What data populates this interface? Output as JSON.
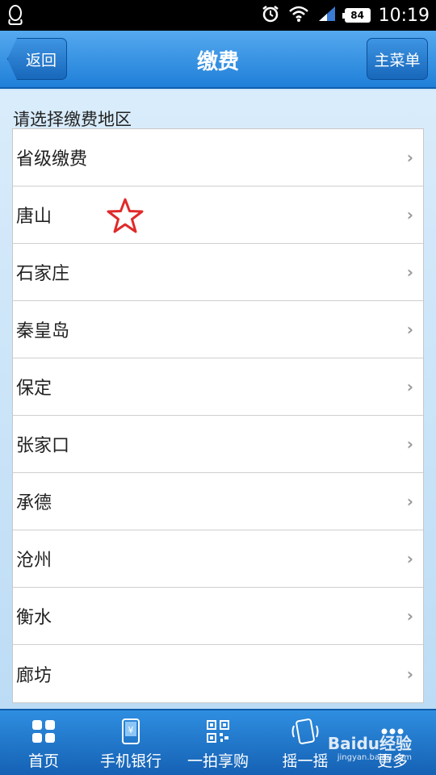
{
  "status_bar": {
    "battery": "84",
    "time": "10:19"
  },
  "header": {
    "title": "缴费",
    "back_label": "返回",
    "menu_label": "主菜单"
  },
  "section_label": "请选择缴费地区",
  "regions": [
    "省级缴费",
    "唐山",
    "石家庄",
    "秦皇岛",
    "保定",
    "张家口",
    "承德",
    "沧州",
    "衡水",
    "廊坊"
  ],
  "bottom_nav": [
    {
      "label": "首页",
      "icon": "grid-home-icon"
    },
    {
      "label": "手机银行",
      "icon": "phone-yen-icon"
    },
    {
      "label": "一拍享购",
      "icon": "qr-code-icon"
    },
    {
      "label": "摇一摇",
      "icon": "shake-phone-icon"
    },
    {
      "label": "更多",
      "icon": "more-dots-icon"
    }
  ],
  "watermark": {
    "brand": "Baidu经验",
    "url": "jingyan.baidu.com"
  },
  "colors": {
    "header": "#2a8ae0",
    "accent_star": "#e02a2a"
  }
}
